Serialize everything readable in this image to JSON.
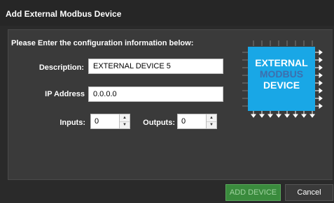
{
  "dialog": {
    "title": "Add External Modbus Device",
    "instructions": "Please Enter the configuration information below:",
    "description_label": "Description:",
    "description_value": "EXTERNAL DEVICE 5",
    "ip_label": "IP Address",
    "ip_value": "0.0.0.0",
    "inputs_label": "Inputs:",
    "inputs_value": "0",
    "outputs_label": "Outputs:",
    "outputs_value": "0",
    "chip_line1": "EXTERNAL",
    "chip_line2": "MODBUS",
    "chip_line3": "DEVICE",
    "add_button": "ADD DEVICE",
    "cancel_button": "Cancel"
  },
  "icons": {
    "spin_up": "▲",
    "spin_down": "▼"
  },
  "colors": {
    "chip_blue": "#19a7e6",
    "chip_accent_text": "#3d6fae",
    "add_button_green": "#3a8b3d",
    "dialog_background": "#2a2a2a",
    "panel_background": "#3a3a3a"
  }
}
